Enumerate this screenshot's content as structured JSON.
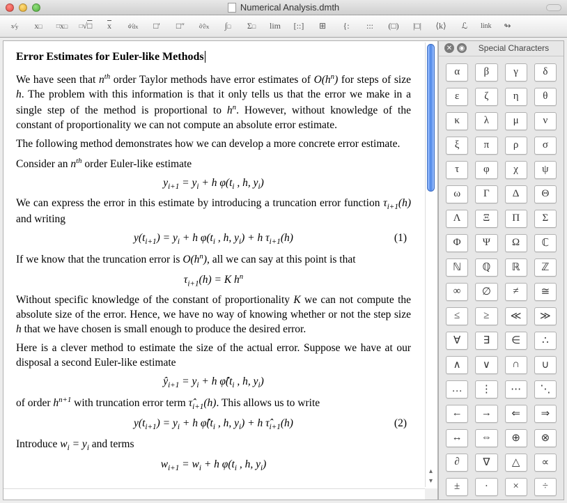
{
  "window": {
    "title": "Numerical Analysis.dmth"
  },
  "toolbar": {
    "items": [
      "x-over-y",
      "x-sub",
      "x-sup",
      "root",
      "x-bar",
      "frac-d",
      "box-prime",
      "box-dprime",
      "d-dx",
      "integral",
      "sigma",
      "lim",
      "matrix",
      "grid",
      "vbar",
      "cells",
      "paren",
      "bracket",
      "angle",
      "script",
      "link",
      "arrow-icon"
    ],
    "link_label": "link"
  },
  "sidebar": {
    "title": "Special Characters",
    "symbols": [
      "α",
      "β",
      "γ",
      "δ",
      "ε",
      "ζ",
      "η",
      "θ",
      "κ",
      "λ",
      "μ",
      "ν",
      "ξ",
      "π",
      "ρ",
      "σ",
      "τ",
      "φ",
      "χ",
      "ψ",
      "ω",
      "Γ",
      "Δ",
      "Θ",
      "Λ",
      "Ξ",
      "Π",
      "Σ",
      "Φ",
      "Ψ",
      "Ω",
      "ℂ",
      "ℕ",
      "ℚ",
      "ℝ",
      "ℤ",
      "∞",
      "∅",
      "≠",
      "≅",
      "≤",
      "≥",
      "≪",
      "≫",
      "∀",
      "∃",
      "∈",
      "∴",
      "∧",
      "∨",
      "∩",
      "∪",
      "…",
      "⋮",
      "⋯",
      "⋱",
      "←",
      "→",
      "⇐",
      "⇒",
      "↔",
      "⇔",
      "⊕",
      "⊗",
      "∂",
      "∇",
      "△",
      "∝",
      "±",
      "·",
      "×",
      "÷"
    ]
  },
  "document": {
    "heading": "Error Estimates for Euler-like Methods",
    "p1a": "We have seen that ",
    "p1b": " order Taylor methods have error estimates of ",
    "p1c": " for steps of size ",
    "p1d": ". The problem with this information is that it only tells us that the error we make in a single step of the method is proportional to ",
    "p1e": ". However, without knowledge of the constant of proportionality we can not compute an absolute error estimate.",
    "p2": "The following method demonstrates how we can develop a more concrete error estimate.",
    "p3a": "Consider an ",
    "p3b": " order Euler-like estimate",
    "eq1": "y_{i+1} = y_i + h φ(t_i , h, y_i)",
    "p4a": "We can express the error in this estimate by introducing a truncation error function ",
    "p4b": " and writing",
    "eq2": "y(t_{i+1}) = y_i + h φ(t_i , h, y_i) + h τ_{i+1}(h)",
    "eq2num": "(1)",
    "p5a": "If we know that the truncation error is ",
    "p5b": ", all we can say at this point is that",
    "eq3": "τ_{i+1}(h) = K h^n",
    "p6a": "Without specific knowledge of the constant of proportionality ",
    "p6b": " we can not compute the absolute size of the error. Hence, we have no way of knowing whether or not the step size ",
    "p6c": " that we have chosen is small enough to produce the desired error.",
    "p7": "Here is a clever method to estimate the size of the actual error. Suppose we have at our disposal a second Euler-like estimate",
    "eq4": "ŷ_{i+1} = y_i + h φ̂(t_i , h, y_i)",
    "p8a": "of order ",
    "p8b": " with truncation error term ",
    "p8c": ". This allows us to write",
    "eq5": "y(t_{i+1}) = y_i + h φ̂(t_i , h, y_i) + h τ̂_{i+1}(h)",
    "eq5num": "(2)",
    "p9a": "Introduce ",
    "p9b": " and terms",
    "eq6": "w_{i+1} = w_i + h φ(t_i , h, y_i)",
    "nth": "n",
    "th": "th",
    "Ohn": "O(h",
    "Ohn_sup": "n",
    "Ohn_close": ")",
    "h": "h",
    "hn": "h",
    "hn_sup": "n",
    "tau": "τ",
    "tau_sub": "i+1",
    "tau_arg": "(h)",
    "K": "K",
    "hnp1": "h",
    "hnp1_sup": "n+1",
    "tauhat": "τ̂",
    "tauhat_sub": "i+1",
    "tauhat_arg": "(h)",
    "wi_eq_yi": "w_i = y_i"
  }
}
